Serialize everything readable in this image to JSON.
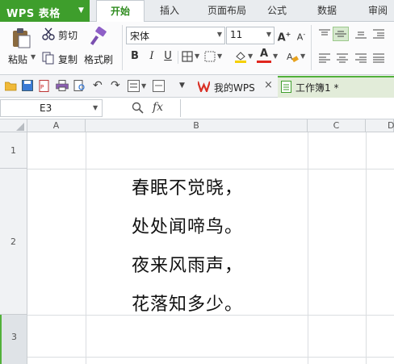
{
  "app": {
    "title": "WPS 表格"
  },
  "tabs": [
    {
      "label": "开始",
      "active": true
    },
    {
      "label": "插入"
    },
    {
      "label": "页面布局"
    },
    {
      "label": "公式"
    },
    {
      "label": "数据"
    },
    {
      "label": "审阅"
    }
  ],
  "ribbon": {
    "clipboard": {
      "paste": "粘贴",
      "cut": "剪切",
      "copy": "复制",
      "format_painter": "格式刷"
    },
    "font": {
      "name": "宋体",
      "size": "11"
    }
  },
  "doc_tabs": [
    {
      "label": "我的WPS",
      "close": "×"
    },
    {
      "label": "工作簿1 *"
    }
  ],
  "formula_bar": {
    "name_box": "E3",
    "fx": "fx",
    "value": ""
  },
  "sheet": {
    "columns": [
      "A",
      "B",
      "C",
      "D"
    ],
    "rows": [
      "1",
      "2",
      "3"
    ],
    "selected_cell": "E3",
    "cell_B2": [
      "春眠不觉晓，",
      "处处闻啼鸟。",
      "夜来风雨声，",
      "花落知多少。"
    ]
  },
  "colors": {
    "accent": "#3e9e2c",
    "ribbon_bg": "#fbfbfc"
  }
}
